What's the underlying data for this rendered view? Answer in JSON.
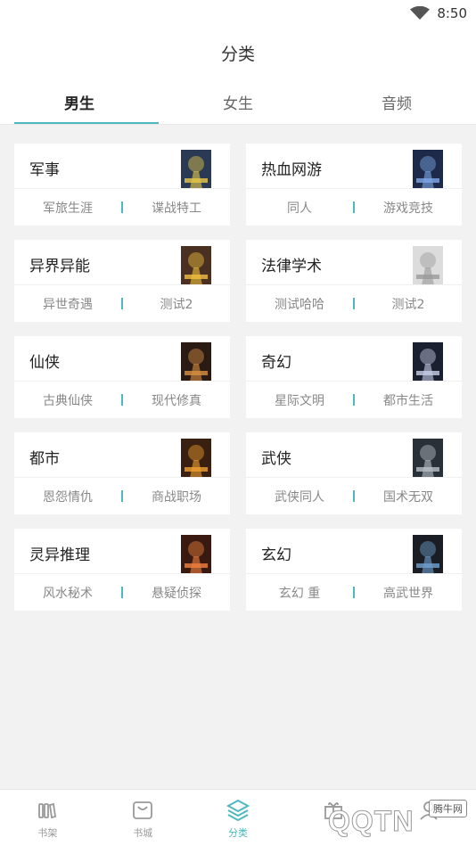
{
  "status_bar": {
    "time": "8:50"
  },
  "header": {
    "title": "分类",
    "tabs": [
      {
        "label": "男生",
        "active": true
      },
      {
        "label": "女生",
        "active": false
      },
      {
        "label": "音频",
        "active": false
      }
    ]
  },
  "categories": [
    {
      "title": "军事",
      "subs": [
        "军旅生涯",
        "谍战特工"
      ],
      "cover_bg": "#2a3a55",
      "cover_accent": "#e8c84a",
      "cover_text": "天启王者"
    },
    {
      "title": "热血网游",
      "subs": [
        "同人",
        "游戏竞技"
      ],
      "cover_bg": "#1e2a4a",
      "cover_accent": "#7fa8e8",
      "cover_text": ""
    },
    {
      "title": "异界异能",
      "subs": [
        "异世奇遇",
        "测试2"
      ],
      "cover_bg": "#4a3020",
      "cover_accent": "#f0c040",
      "cover_text": ""
    },
    {
      "title": "法律学术",
      "subs": [
        "测试哈哈",
        "测试2"
      ],
      "cover_bg": "#dcdcdc",
      "cover_accent": "#9a9a9a",
      "cover_text": ""
    },
    {
      "title": "仙侠",
      "subs": [
        "古典仙侠",
        "现代修真"
      ],
      "cover_bg": "#2a1a14",
      "cover_accent": "#d89040",
      "cover_text": ""
    },
    {
      "title": "奇幻",
      "subs": [
        "星际文明",
        "都市生活"
      ],
      "cover_bg": "#1a2030",
      "cover_accent": "#c8d0e8",
      "cover_text": ""
    },
    {
      "title": "都市",
      "subs": [
        "恩怨情仇",
        "商战职场"
      ],
      "cover_bg": "#3a2010",
      "cover_accent": "#f0a030",
      "cover_text": ""
    },
    {
      "title": "武侠",
      "subs": [
        "武侠同人",
        "国术无双"
      ],
      "cover_bg": "#2a3038",
      "cover_accent": "#b8c0c8",
      "cover_text": ""
    },
    {
      "title": "灵异推理",
      "subs": [
        "风水秘术",
        "悬疑侦探"
      ],
      "cover_bg": "#3a1a10",
      "cover_accent": "#f08040",
      "cover_text": ""
    },
    {
      "title": "玄幻",
      "subs": [
        "玄幻 重",
        "高武世界"
      ],
      "cover_bg": "#1a1e24",
      "cover_accent": "#70a0d0",
      "cover_text": ""
    }
  ],
  "bottom_nav": [
    {
      "label": "书架",
      "icon": "bookshelf-icon",
      "active": false
    },
    {
      "label": "书城",
      "icon": "store-icon",
      "active": false
    },
    {
      "label": "分类",
      "icon": "layers-icon",
      "active": true
    },
    {
      "label": "",
      "icon": "gift-icon",
      "active": false
    },
    {
      "label": "",
      "icon": "profile-icon",
      "active": false
    }
  ],
  "watermark": {
    "logo_text": "QQTN",
    "site_label": "腾牛网"
  },
  "colors": {
    "accent": "#4fb8bf",
    "background": "#f2f2f2",
    "card": "#ffffff"
  }
}
